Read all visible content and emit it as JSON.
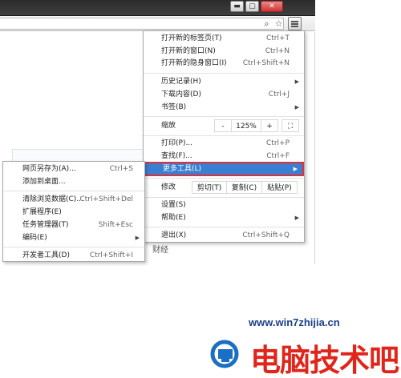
{
  "main_menu": {
    "items": [
      {
        "label": "打开新的标签页(T)",
        "shortcut": "Ctrl+T"
      },
      {
        "label": "打开新的窗口(N)",
        "shortcut": "Ctrl+N"
      },
      {
        "label": "打开新的隐身窗口(I)",
        "shortcut": "Ctrl+Shift+N"
      },
      {
        "label": "历史记录(H)",
        "shortcut": ""
      },
      {
        "label": "下载内容(D)",
        "shortcut": "Ctrl+J"
      },
      {
        "label": "书签(B)",
        "shortcut": ""
      },
      {
        "label": "打印(P)...",
        "shortcut": "Ctrl+P"
      },
      {
        "label": "查找(F)...",
        "shortcut": "Ctrl+F"
      },
      {
        "label": "更多工具(L)",
        "shortcut": ""
      },
      {
        "label": "设置(S)",
        "shortcut": ""
      },
      {
        "label": "帮助(E)",
        "shortcut": ""
      },
      {
        "label": "退出(X)",
        "shortcut": "Ctrl+Shift+Q"
      }
    ],
    "zoom": {
      "label": "缩放",
      "minus": "-",
      "value": "125%",
      "plus": "+",
      "fullscreen": "⛶"
    },
    "edit": {
      "label": "修改",
      "cut": "剪切(T)",
      "copy": "复制(C)",
      "paste": "粘贴(P)"
    }
  },
  "sub_menu": {
    "items": [
      {
        "label": "网页另存为(A)...",
        "shortcut": "Ctrl+S"
      },
      {
        "label": "添加到桌面...",
        "shortcut": ""
      },
      {
        "label": "清除浏览数据(C)...",
        "shortcut": "Ctrl+Shift+Del"
      },
      {
        "label": "扩展程序(E)",
        "shortcut": ""
      },
      {
        "label": "任务管理器(T)",
        "shortcut": "Shift+Esc"
      },
      {
        "label": "编码(E)",
        "shortcut": ""
      },
      {
        "label": "开发者工具(D)",
        "shortcut": "Ctrl+Shift+I"
      }
    ]
  },
  "page": {
    "fragment": "财经"
  },
  "watermark": {
    "url": "www.win7zhijia.cn",
    "text": "电脑技术吧"
  },
  "colors": {
    "highlight": "#3a7fd0",
    "highlight_border": "#e0303a",
    "watermark_red": "#e1251b",
    "watermark_blue": "#1a3f8a"
  },
  "icons": {
    "zoom": "zoom-icon",
    "star": "bookmark-star-icon",
    "menu": "hamburger-menu-icon"
  }
}
